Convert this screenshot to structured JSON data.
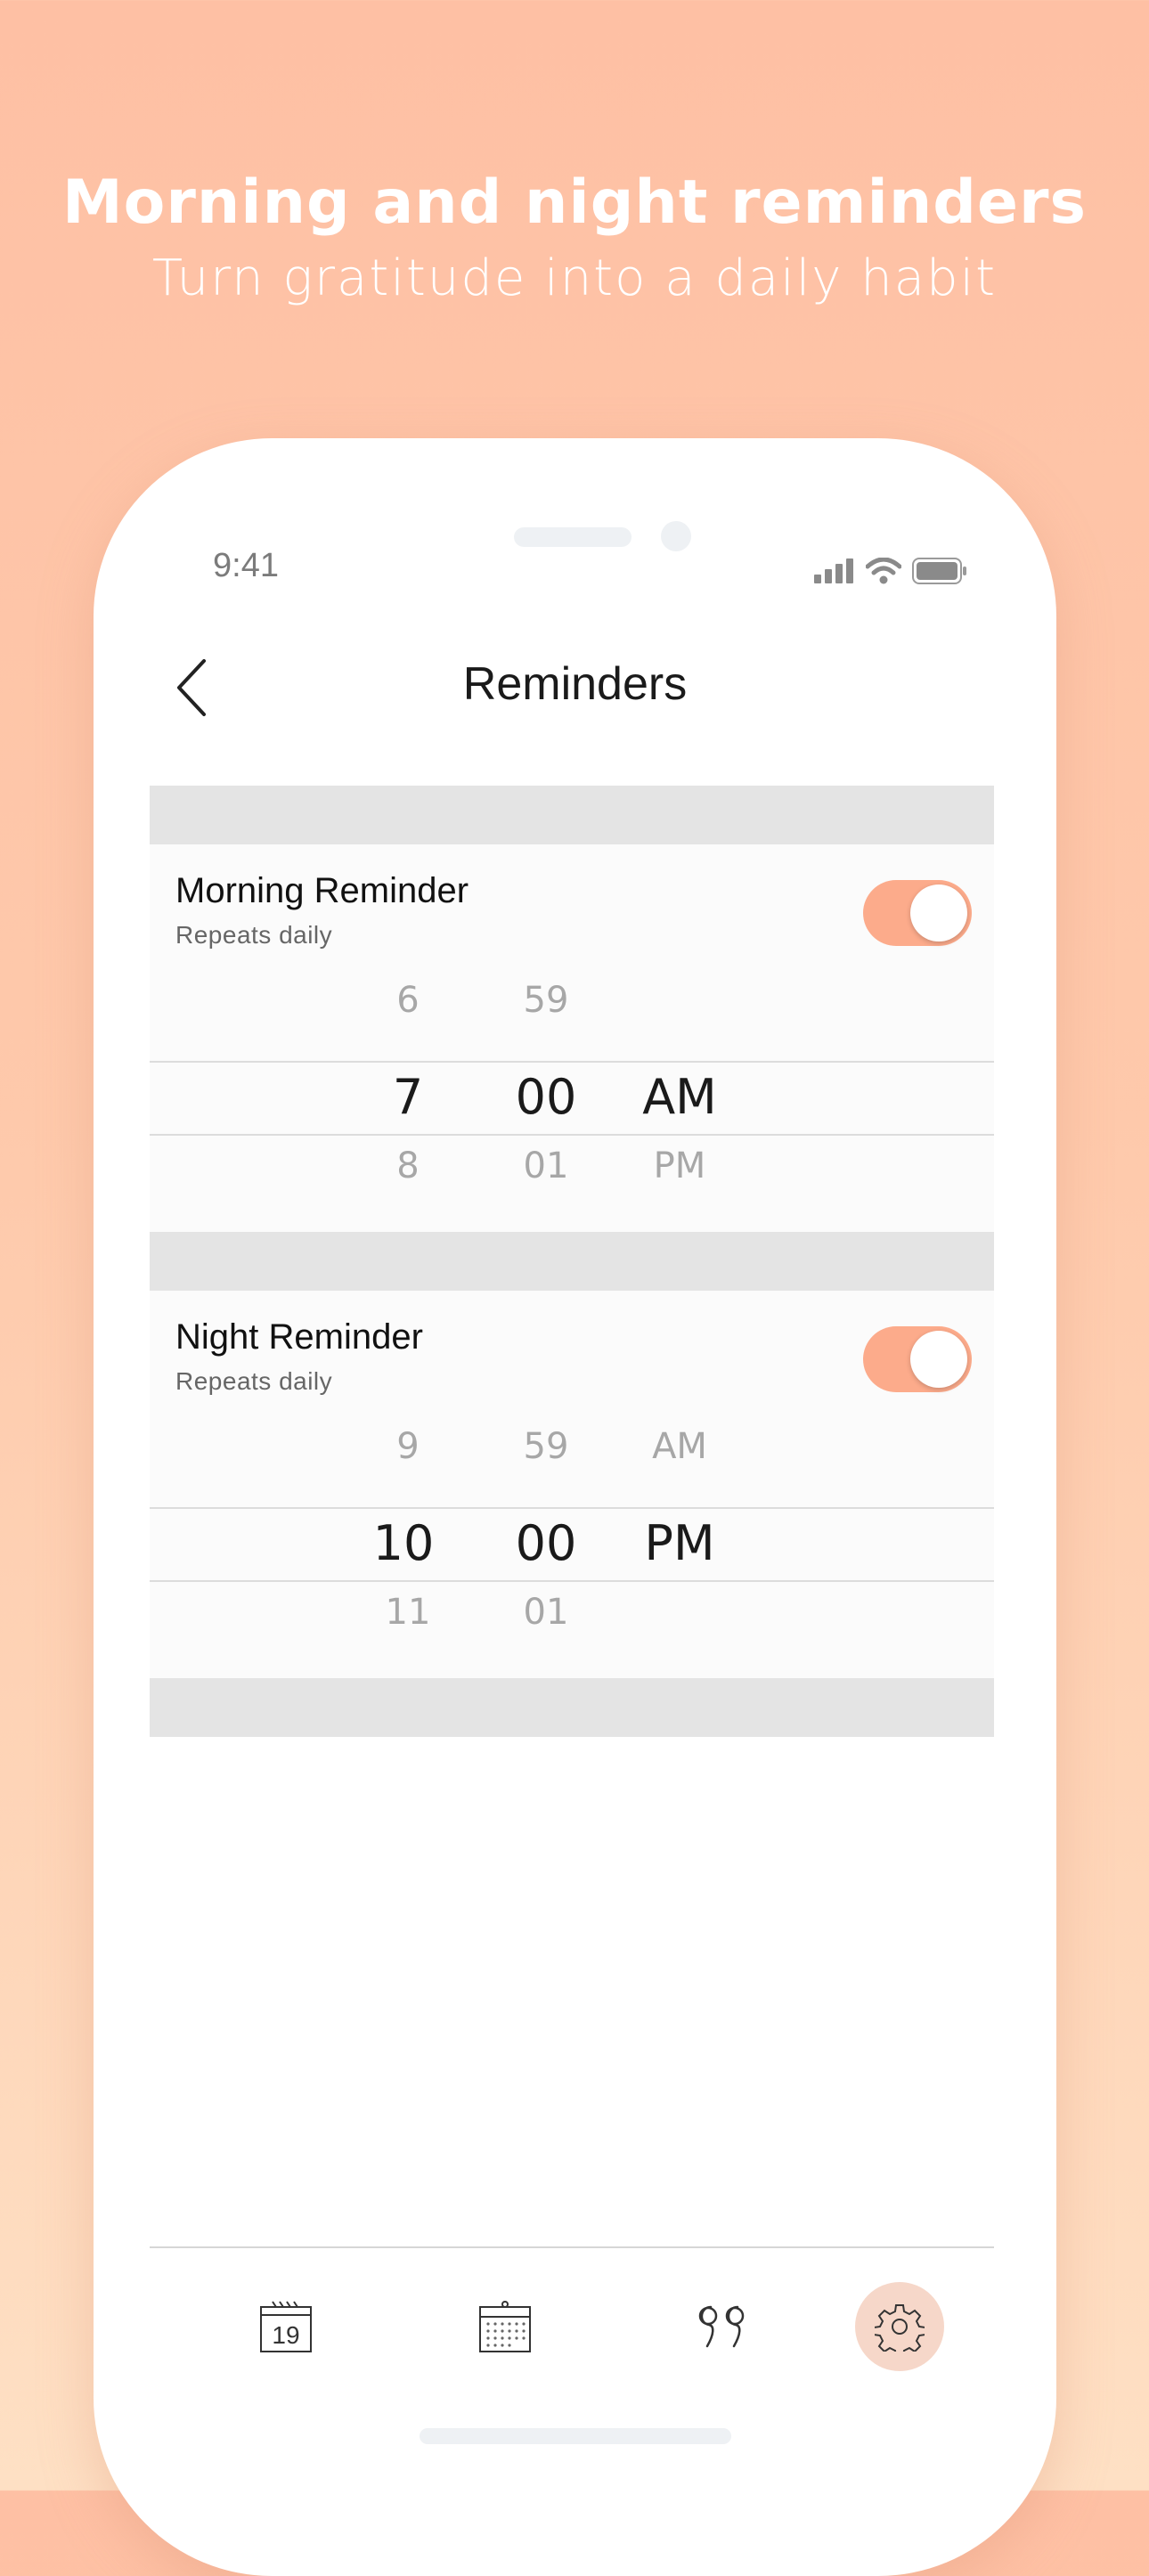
{
  "promo": {
    "title": "Morning and night reminders",
    "subtitle": "Turn gratitude into a daily habit"
  },
  "status_bar": {
    "time": "9:41",
    "icons": [
      "signal-icon",
      "wifi-icon",
      "battery-icon"
    ]
  },
  "nav": {
    "title": "Reminders",
    "back_icon": "chevron-left-icon"
  },
  "reminders": [
    {
      "title": "Morning Reminder",
      "subtitle": "Repeats daily",
      "enabled": true,
      "picker": {
        "hour_above": "6",
        "hour": "7",
        "hour_below": "8",
        "minute_above": "59",
        "minute": "00",
        "minute_below": "01",
        "period_above": "",
        "period": "AM",
        "period_below": "PM"
      }
    },
    {
      "title": "Night Reminder",
      "subtitle": "Repeats daily",
      "enabled": true,
      "picker": {
        "hour_above": "9",
        "hour": "10",
        "hour_below": "11",
        "minute_above": "59",
        "minute": "00",
        "minute_below": "01",
        "period_above": "AM",
        "period": "PM",
        "period_below": ""
      }
    }
  ],
  "tabbar": {
    "items": [
      {
        "icon": "daily-calendar-icon",
        "day_label": "19",
        "active": false
      },
      {
        "icon": "month-calendar-icon",
        "active": false
      },
      {
        "icon": "quote-icon",
        "active": false
      },
      {
        "icon": "settings-gear-icon",
        "active": true
      }
    ]
  },
  "colors": {
    "accent": "#fcab8b",
    "background_top": "#fec0a4",
    "background_bottom": "#fee0c4",
    "active_tab_bg": "#f6d7c9"
  }
}
